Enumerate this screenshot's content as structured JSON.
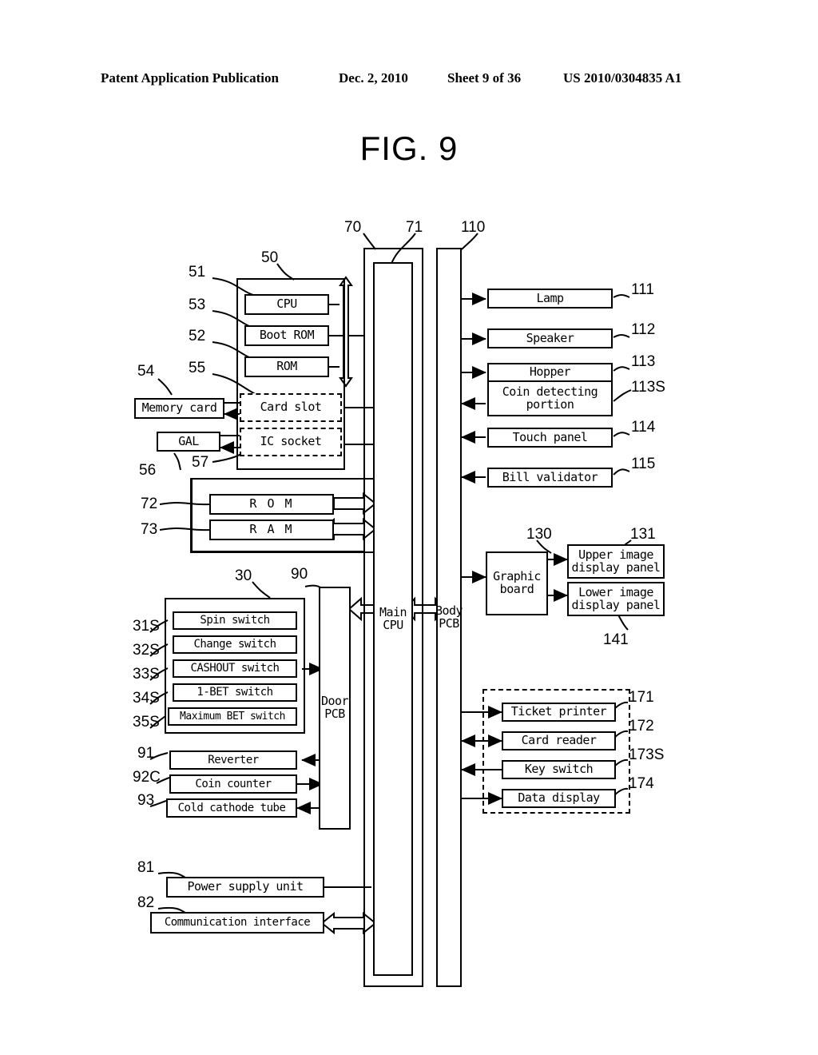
{
  "header": {
    "publication": "Patent Application Publication",
    "date": "Dec. 2, 2010",
    "sheet": "Sheet 9 of 36",
    "number": "US 2010/0304835 A1"
  },
  "figure": {
    "title": "FIG. 9"
  },
  "gaming_board": {
    "ref": "50",
    "cpu": {
      "ref": "51",
      "label": "CPU"
    },
    "boot_rom": {
      "ref": "53",
      "label": "Boot ROM"
    },
    "rom": {
      "ref": "52",
      "label": "ROM"
    },
    "card_slot": {
      "ref": "55",
      "label": "Card slot"
    },
    "ic_socket": {
      "ref": "57",
      "label": "IC socket"
    }
  },
  "external_left": {
    "memory_card": {
      "ref": "54",
      "label": "Memory card"
    },
    "gal": {
      "ref": "56",
      "label": "GAL"
    }
  },
  "memory": {
    "rom": {
      "ref": "72",
      "label": "R O M"
    },
    "ram": {
      "ref": "73",
      "label": "R A M"
    }
  },
  "buses": {
    "motherboard": {
      "ref": "70"
    },
    "main_cpu": {
      "ref": "71",
      "label": "Main\nCPU",
      "line1": "Main",
      "line2": "CPU"
    },
    "body_pcb": {
      "ref": "110",
      "label": "Body\nPCB",
      "line1": "Body",
      "line2": "PCB"
    },
    "door_pcb": {
      "ref": "90",
      "label": "Door\nPCB",
      "line1": "Door",
      "line2": "PCB"
    }
  },
  "body_devices": [
    {
      "ref": "111",
      "label": "Lamp"
    },
    {
      "ref": "112",
      "label": "Speaker"
    },
    {
      "ref": "113",
      "label": "Hopper"
    },
    {
      "ref": "113S",
      "label": "Coin detecting\nportion",
      "line1": "Coin detecting",
      "line2": "portion"
    },
    {
      "ref": "114",
      "label": "Touch panel"
    },
    {
      "ref": "115",
      "label": "Bill validator"
    }
  ],
  "graphics": {
    "graphic_board": {
      "ref": "130",
      "label": "Graphic\nboard",
      "line1": "Graphic",
      "line2": "board"
    },
    "upper_panel": {
      "ref": "131",
      "label": "Upper image\ndisplay panel",
      "line1": "Upper image",
      "line2": "display panel"
    },
    "lower_panel": {
      "ref": "141",
      "label": "Lower image\ndisplay panel",
      "line1": "Lower image",
      "line2": "display panel"
    }
  },
  "switch_group": {
    "ref": "30",
    "items": [
      {
        "ref": "31S",
        "label": "Spin switch"
      },
      {
        "ref": "32S",
        "label": "Change switch"
      },
      {
        "ref": "33S",
        "label": "CASHOUT switch"
      },
      {
        "ref": "34S",
        "label": "1-BET switch"
      },
      {
        "ref": "35S",
        "label": "Maximum BET switch"
      }
    ]
  },
  "door_devices": [
    {
      "ref": "91",
      "label": "Reverter"
    },
    {
      "ref": "92C",
      "label": "Coin counter"
    },
    {
      "ref": "93",
      "label": "Cold cathode tube"
    }
  ],
  "peripheral_group": {
    "items": [
      {
        "ref": "171",
        "label": "Ticket printer"
      },
      {
        "ref": "172",
        "label": "Card reader"
      },
      {
        "ref": "173S",
        "label": "Key switch"
      },
      {
        "ref": "174",
        "label": "Data display"
      }
    ]
  },
  "power": [
    {
      "ref": "81",
      "label": "Power supply unit"
    },
    {
      "ref": "82",
      "label": "Communication interface"
    }
  ]
}
